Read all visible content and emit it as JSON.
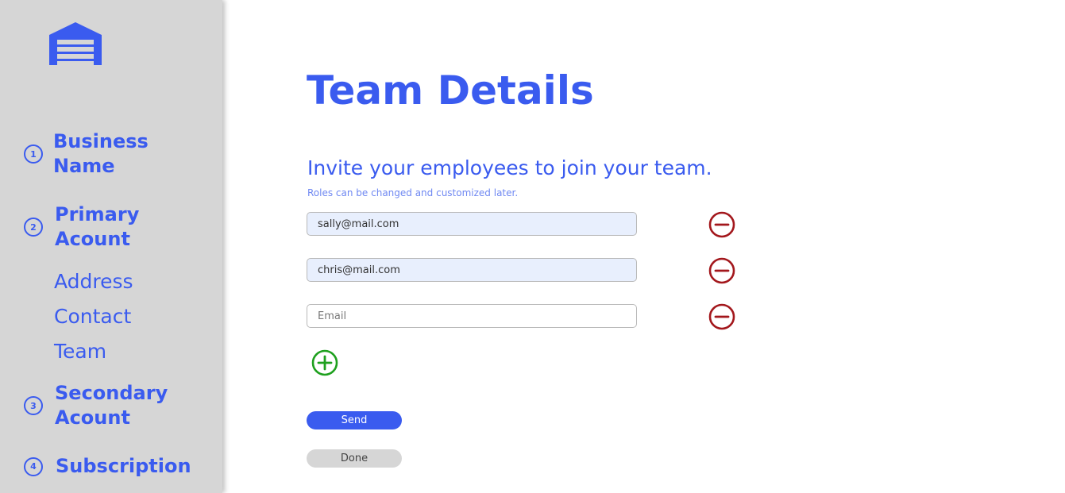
{
  "sidebar": {
    "steps": [
      {
        "number": "1",
        "label": "Business Name"
      },
      {
        "number": "2",
        "label": "Primary Acount"
      },
      {
        "number": "3",
        "label": "Secondary Acount"
      },
      {
        "number": "4",
        "label": "Subscription"
      }
    ],
    "substeps": [
      "Address",
      "Contact",
      "Team"
    ]
  },
  "main": {
    "title": "Team Details",
    "subtitle": "Invite your employees to join your team.",
    "hint": "Roles can be changed and customized later.",
    "emails": [
      {
        "value": "sally@mail.com",
        "placeholder": "Email"
      },
      {
        "value": "chris@mail.com",
        "placeholder": "Email"
      },
      {
        "value": "",
        "placeholder": "Email"
      }
    ],
    "send_label": "Send",
    "done_label": "Done"
  },
  "colors": {
    "accent": "#3a5bef",
    "sidebar_bg": "#d6d6d6",
    "remove": "#a3171c",
    "add": "#1ea01e"
  },
  "icons": {
    "logo": "garage-icon",
    "remove": "minus-circle-icon",
    "add": "plus-circle-icon"
  }
}
